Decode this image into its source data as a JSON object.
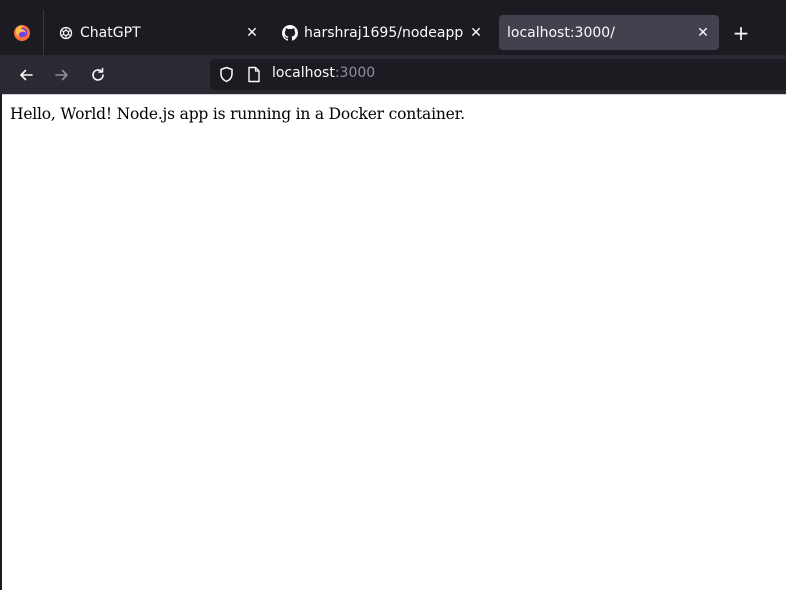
{
  "tabs": [
    {
      "label": "ChatGPT",
      "icon": "chatgpt-icon",
      "active": false
    },
    {
      "label": "harshraj1695/nodeapp",
      "icon": "github-icon",
      "active": false
    },
    {
      "label": "localhost:3000/",
      "icon": "",
      "active": true
    }
  ],
  "tab_close_glyph": "✕",
  "new_tab_glyph": "+",
  "url": {
    "host": "localhost",
    "port": ":3000"
  },
  "page": {
    "text": "Hello, World! Node.js app is running in a Docker container."
  },
  "colors": {
    "chrome_dark": "#1c1b22",
    "toolbar": "#2b2a33",
    "active_tab": "#42414d",
    "page_bg": "#ffffff"
  }
}
